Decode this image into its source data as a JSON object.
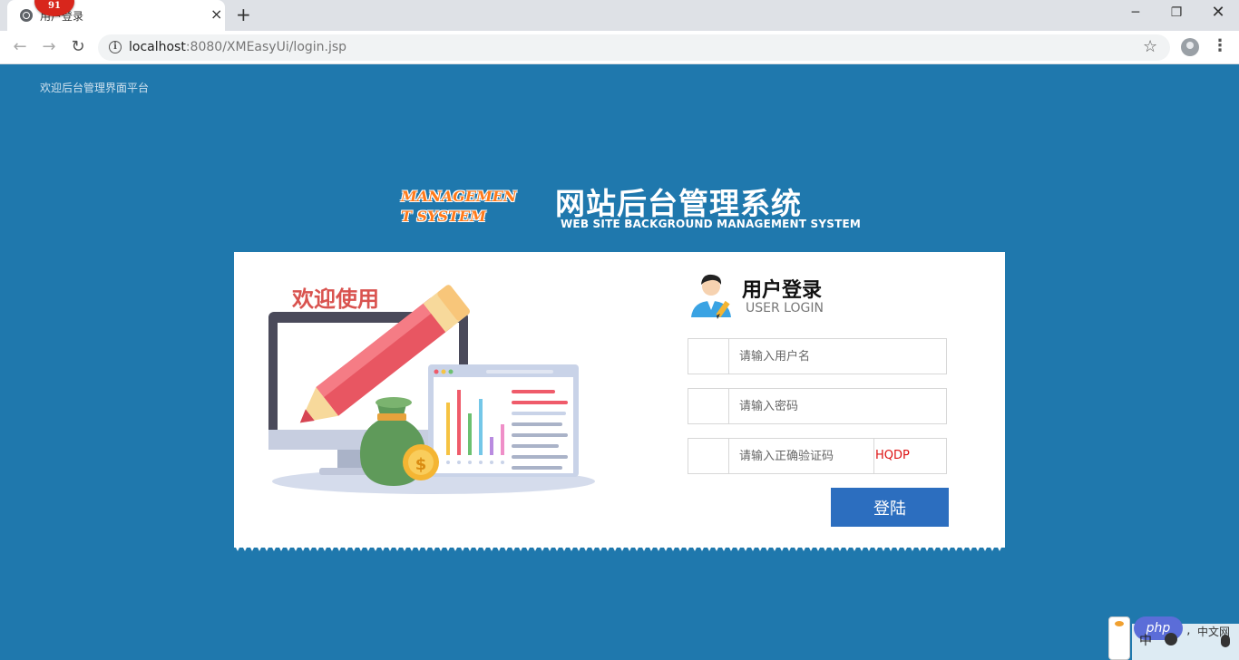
{
  "browser": {
    "tab_title": "用户登录",
    "tab_badge": "91",
    "tab_close": "×",
    "new_tab": "+",
    "url_host": "localhost",
    "url_path": ":8080/XMEasyUi/login.jsp",
    "icons": {
      "back": "arrow-left-icon",
      "forward": "arrow-right-icon",
      "reload": "reload-icon",
      "info": "info-icon",
      "star": "star-icon",
      "profile": "profile-icon",
      "menu": "menu-icon"
    },
    "win_min": "─",
    "win_max": "❐",
    "win_close": "✕"
  },
  "page": {
    "welcome": "欢迎后台管理界面平台",
    "logo_en_line1": "MANAGEMEN",
    "logo_en_line2": "T SYSTEM",
    "logo_cn": "网站后台管理系统",
    "logo_sub": "WEB SITE BACKGROUND MANAGEMENT SYSTEM",
    "background_color": "#1f78ad",
    "accent_orange": "#ff7a1a"
  },
  "card": {
    "illustration_title": "欢迎使用",
    "login_title": "用户登录",
    "login_subtitle": "USER LOGIN",
    "username_placeholder": "请输入用户名",
    "password_placeholder": "请输入密码",
    "captcha_placeholder": "请输入正确验证码",
    "captcha_text": "HQDP",
    "login_button": "登陆",
    "button_color": "#2c6ebf"
  },
  "ime": {
    "pill": "php",
    "label_left": "中",
    "label_right": "中文网"
  }
}
